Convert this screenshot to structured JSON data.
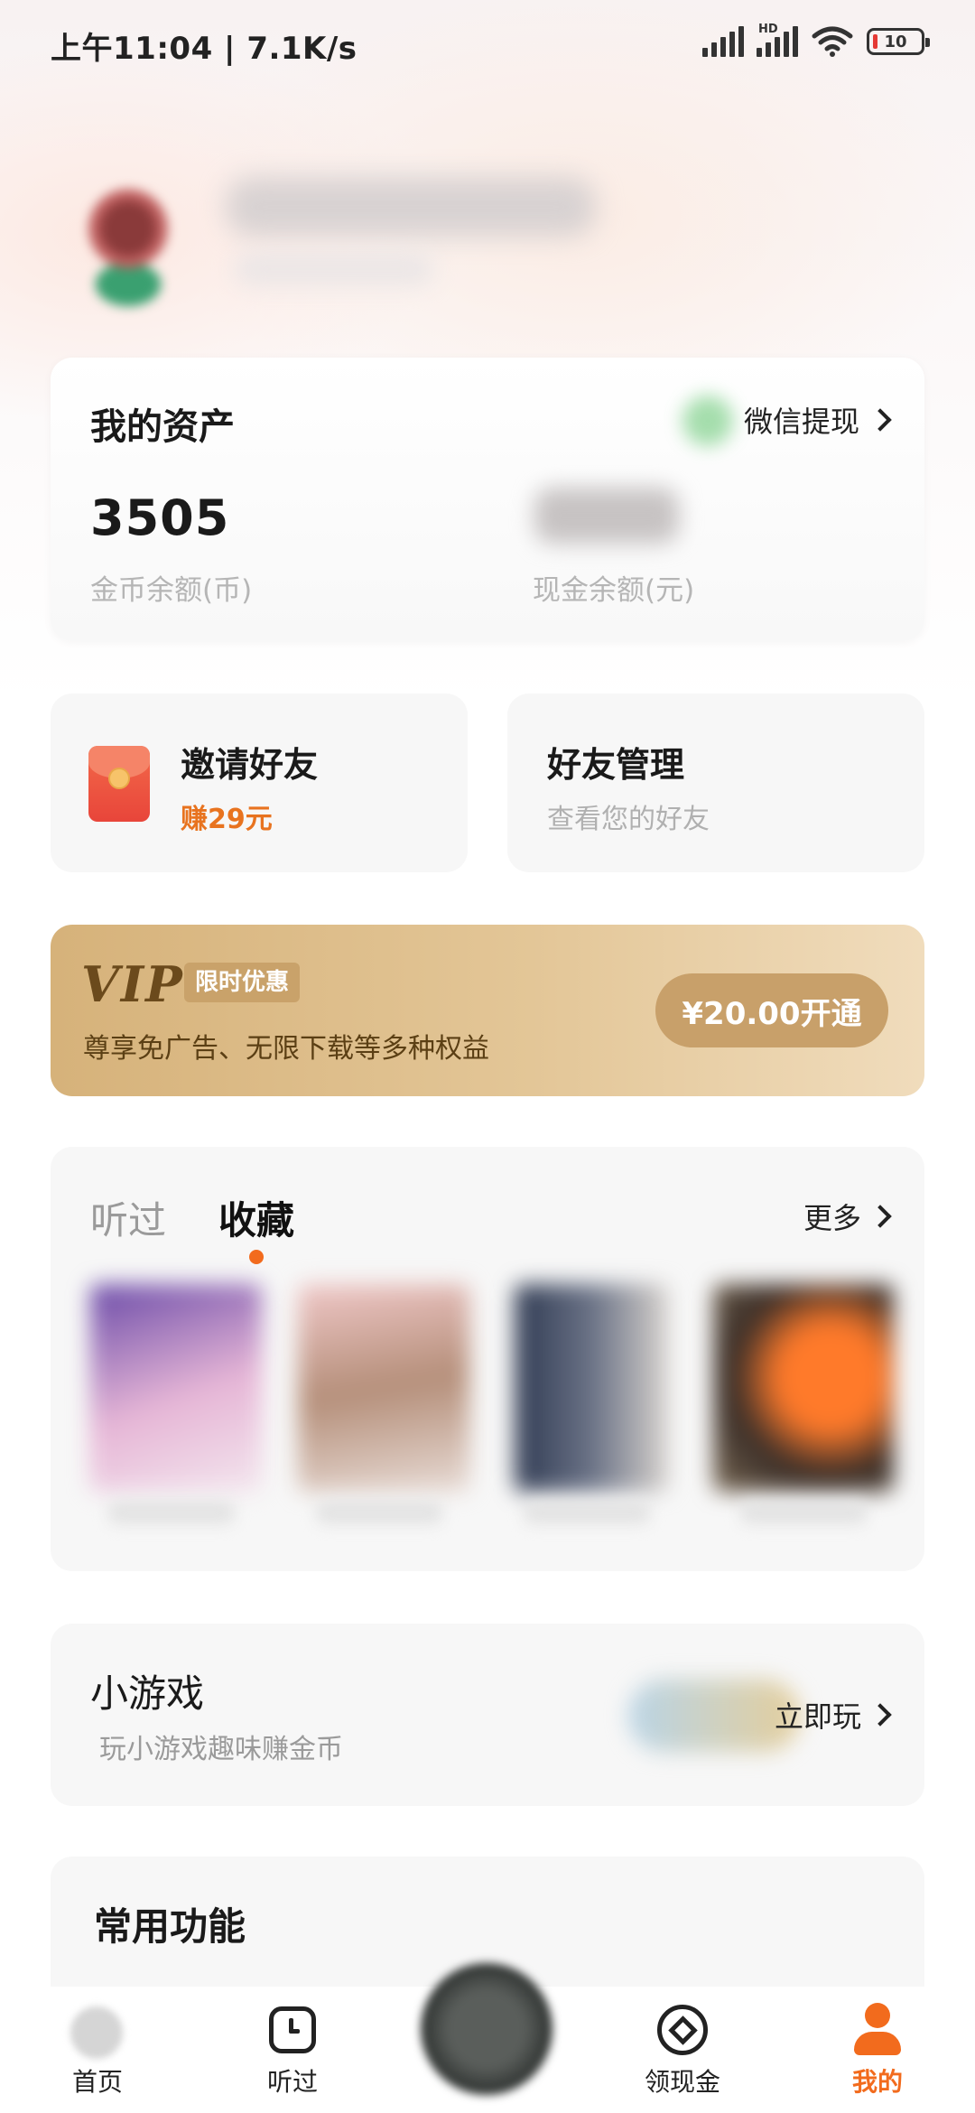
{
  "status_bar": {
    "time": "上午11:04 | 7.1K/s",
    "battery": "10",
    "hd": "HD",
    "icons": [
      "signal-icon",
      "hd-signal-icon",
      "wifi-icon",
      "battery-icon"
    ]
  },
  "assets": {
    "title": "我的资产",
    "wechat_withdraw": "微信提现",
    "coin_value": "3505",
    "coin_label": "金币余额(币)",
    "cash_label": "现金余额(元)"
  },
  "invite": {
    "title": "邀请好友",
    "reward": "赚29元"
  },
  "friends": {
    "title": "好友管理",
    "subtitle": "查看您的好友"
  },
  "vip": {
    "logo": "VIP",
    "badge": "限时优惠",
    "description": "尊享免广告、无限下载等多种权益",
    "button": "¥20.00开通"
  },
  "history": {
    "tabs": [
      "听过",
      "收藏"
    ],
    "active_tab": "收藏",
    "more": "更多"
  },
  "games": {
    "title": "小游戏",
    "subtitle": "玩小游戏趣味赚金币",
    "play": "立即玩"
  },
  "common": {
    "title": "常用功能"
  },
  "bottom_nav": {
    "items": [
      {
        "label": "首页",
        "icon": "home-icon"
      },
      {
        "label": "听过",
        "icon": "clock-icon"
      },
      {
        "label": "领现金",
        "icon": "cash-icon"
      },
      {
        "label": "我的",
        "icon": "person-icon"
      }
    ],
    "active": "我的"
  },
  "colors": {
    "accent": "#f26b1d",
    "vip_gold": "#c8a06a",
    "card_bg": "#f7f7f7"
  }
}
